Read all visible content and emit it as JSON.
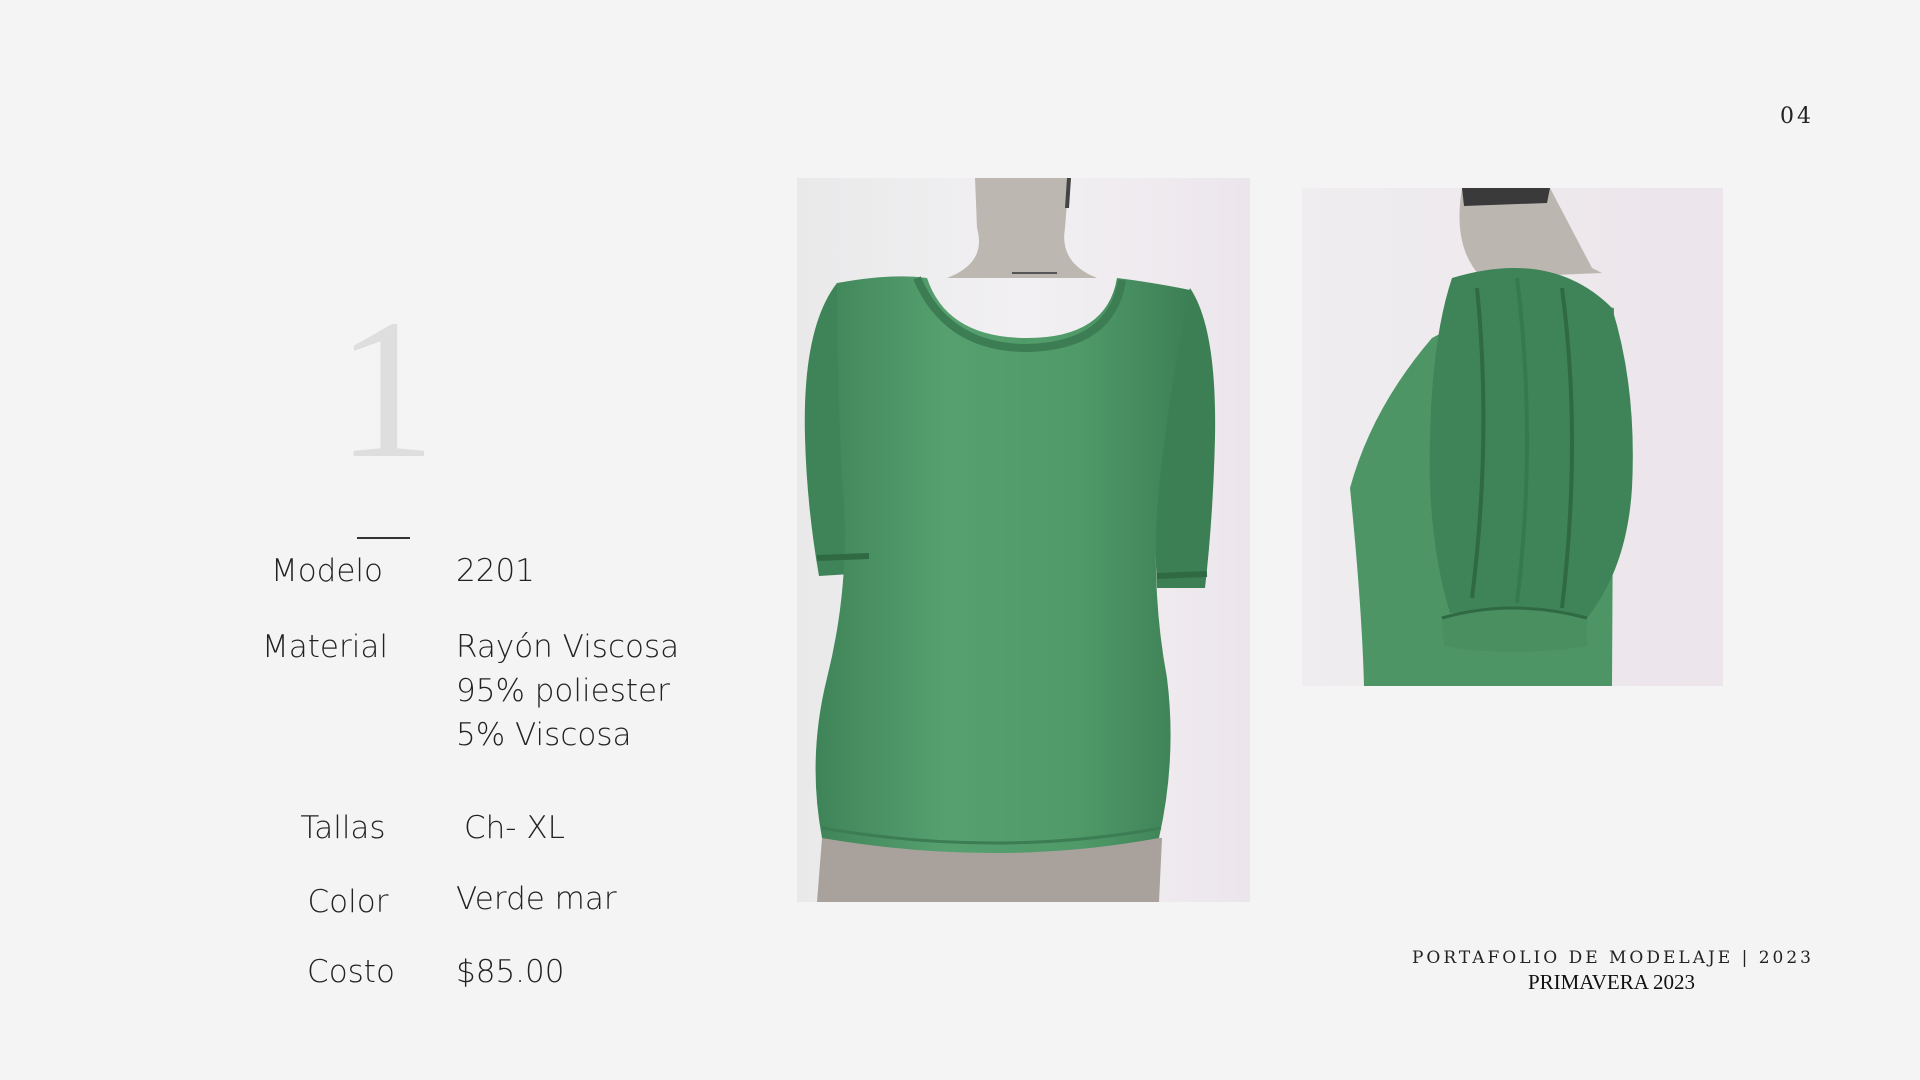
{
  "page": {
    "page_number": "04",
    "item_number": "1"
  },
  "specs": {
    "model": {
      "label": "Modelo",
      "value": "2201"
    },
    "material": {
      "label": "Material",
      "lines": [
        "Rayón Viscosa",
        "95% poliester",
        "5% Viscosa"
      ]
    },
    "sizes": {
      "label": "Tallas",
      "value": "Ch- XL"
    },
    "color": {
      "label": "Color",
      "value": "Verde mar"
    },
    "cost": {
      "label": "Costo",
      "value": "$85.00"
    }
  },
  "footer": {
    "title": "PORTAFOLIO DE MODELAJE | 2023",
    "subtitle": "PRIMAVERA 2023"
  },
  "colors": {
    "background": "#f4f4f4",
    "garment": "#4f9a68",
    "garment_shadow": "#3c7d53",
    "mannequin": "#bdb7b1",
    "photo_backdrop": "#ecebed"
  },
  "icons": {
    "front_photo": "mannequin-front-photo",
    "side_photo": "mannequin-side-photo"
  }
}
